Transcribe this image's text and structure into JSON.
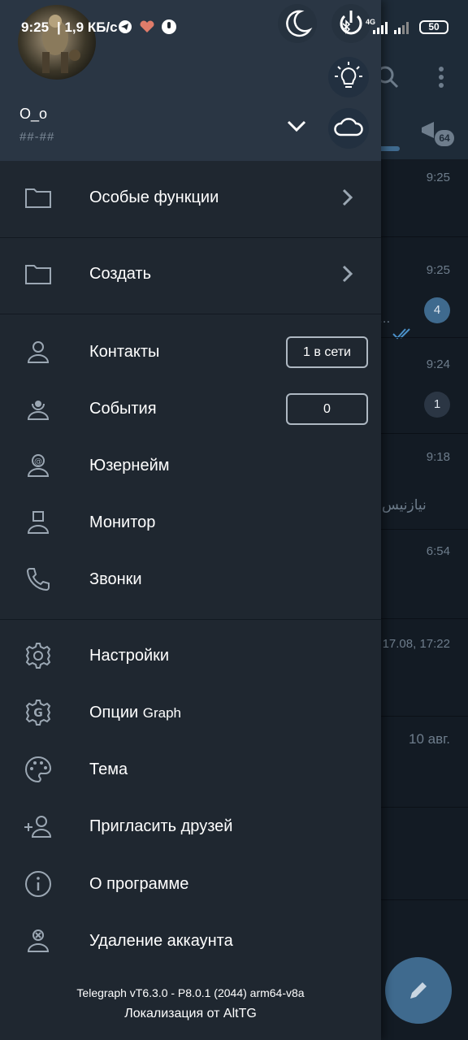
{
  "status": {
    "time": "9:25",
    "speed": "| 1,9 КБ/с",
    "network": "4G",
    "battery": "50"
  },
  "profile": {
    "name": "O_o",
    "phone": "##-##"
  },
  "menu": {
    "special": "Особые функции",
    "create": "Создать",
    "contacts": "Контакты",
    "contacts_badge": "1 в сети",
    "events": "События",
    "events_badge": "0",
    "username": "Юзернейм",
    "monitor": "Монитор",
    "calls": "Звонки",
    "settings": "Настройки",
    "graph_options_prefix": "Опции",
    "graph_options_suffix": "Graph",
    "theme": "Тема",
    "invite": "Пригласить друзей",
    "about": "О программе",
    "delete_account": "Удаление аккаунта"
  },
  "footer": {
    "version": "Telegraph vT6.3.0 - P8.0.1 (2044) arm64-v8a",
    "locale": "Локализация от AltTG"
  },
  "background_chats": {
    "folder_badge": "64",
    "times": [
      "9:25",
      "9:25",
      "9:24",
      "9:18",
      "6:54",
      "17.08, 17:22",
      "10 авг."
    ],
    "counts": [
      "4",
      "1"
    ],
    "snippet_ellipsis": "...",
    "arabic_snippet": "نیازنیس"
  },
  "colors": {
    "drawer_bg": "#1f2730",
    "header_bg": "#2a3644",
    "accent": "#3f6a8e"
  }
}
